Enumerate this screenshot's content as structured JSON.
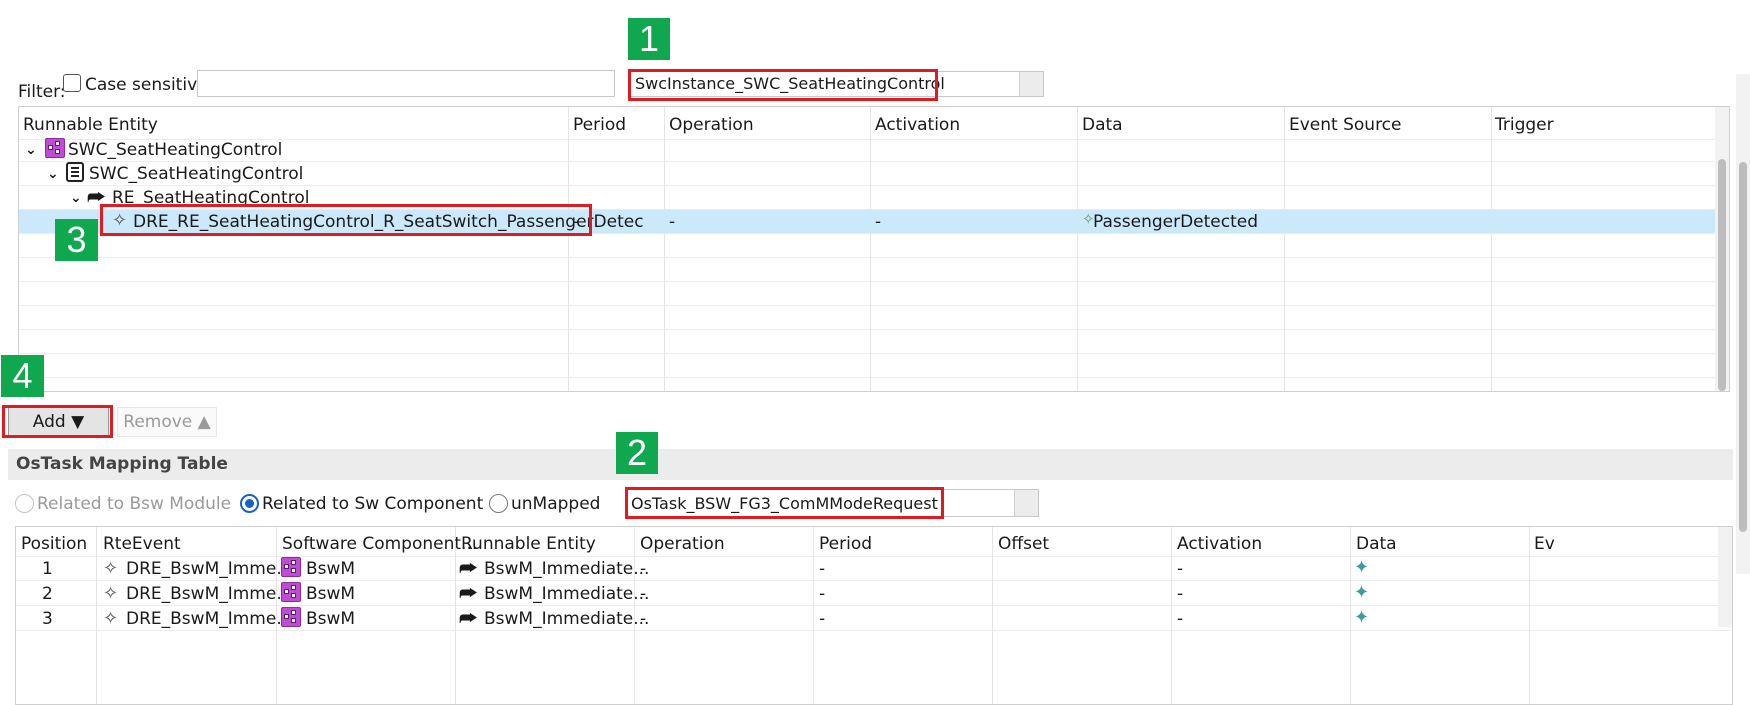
{
  "markers": {
    "m1": "1",
    "m2": "2",
    "m3": "3",
    "m4": "4"
  },
  "filter": {
    "label": "Filter:",
    "case_label": "Case sensitive",
    "swc_value": "SwcInstance_SWC_SeatHeatingControl"
  },
  "upper": {
    "columns": [
      "Runnable Entity",
      "Period",
      "Operation",
      "Activation",
      "Data",
      "Event Source",
      "Trigger"
    ],
    "tree": {
      "row1": "SWC_SeatHeatingControl",
      "row2": "SWC_SeatHeatingControl",
      "row3": "RE_SeatHeatingControl",
      "row4": "DRE_RE_SeatHeatingControl_R_SeatSwitch_PassengerDetec"
    },
    "selected": {
      "period": "-",
      "operation": "-",
      "activation": "-",
      "data": "PassengerDetected"
    }
  },
  "buttons": {
    "add": "Add ▼",
    "remove": "Remove ▲"
  },
  "section_title": "OsTask Mapping Table",
  "radios": {
    "bsw": "Related to Bsw Module",
    "swc": "Related to Sw Component",
    "unmapped": "unMapped"
  },
  "ostask_value": "OsTask_BSW_FG3_ComMModeRequest",
  "lower": {
    "columns": [
      "Position",
      "RteEvent",
      "Software Component...",
      "Runnable Entity",
      "Operation",
      "Period",
      "Offset",
      "Activation",
      "Data",
      "Ev"
    ],
    "rows": [
      {
        "position": "1",
        "event": "DRE_BswM_Imme...",
        "component": "BswM",
        "runnable": "BswM_Immediate...",
        "operation": "-",
        "period": "-",
        "activation": "-"
      },
      {
        "position": "2",
        "event": "DRE_BswM_Imme...",
        "component": "BswM",
        "runnable": "BswM_Immediate...",
        "operation": "-",
        "period": "-",
        "activation": "-"
      },
      {
        "position": "3",
        "event": "DRE_BswM_Imme...",
        "component": "BswM",
        "runnable": "BswM_Immediate...",
        "operation": "-",
        "period": "-",
        "activation": "-"
      }
    ]
  },
  "icons": {
    "component": "component-icon",
    "prototype": "prototype-icon",
    "runnable": "runnable-arrow-icon",
    "event": "event-diamond-icon",
    "data": "data-element-icon"
  },
  "colors": {
    "marker": "#10a84f",
    "highlight": "#e11b22",
    "selection": "#cce8fb",
    "radio": "#1565c0"
  }
}
